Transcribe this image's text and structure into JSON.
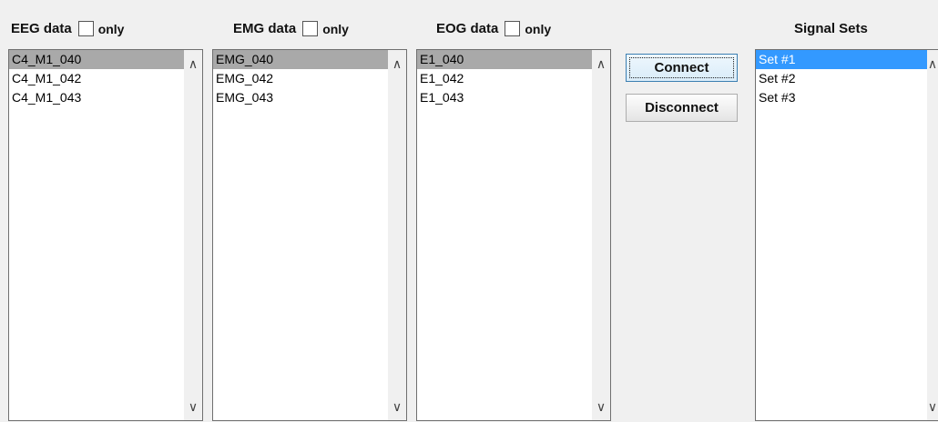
{
  "eeg": {
    "label": "EEG data",
    "only_label": "only",
    "items": [
      "C4_M1_040",
      "C4_M1_042",
      "C4_M1_043"
    ]
  },
  "emg": {
    "label": "EMG data",
    "only_label": "only",
    "items": [
      "EMG_040",
      "EMG_042",
      "EMG_043"
    ]
  },
  "eog": {
    "label": "EOG data",
    "only_label": "only",
    "items": [
      "E1_040",
      "E1_042",
      "E1_043"
    ]
  },
  "actions": {
    "connect_label": "Connect",
    "disconnect_label": "Disconnect"
  },
  "signal_sets": {
    "label": "Signal Sets",
    "items": [
      "Set #1",
      "Set #2",
      "Set #3"
    ]
  },
  "colors": {
    "selection_inactive": "#a9a9a9",
    "selection_active": "#3399ff",
    "background": "#f0f0f0"
  }
}
